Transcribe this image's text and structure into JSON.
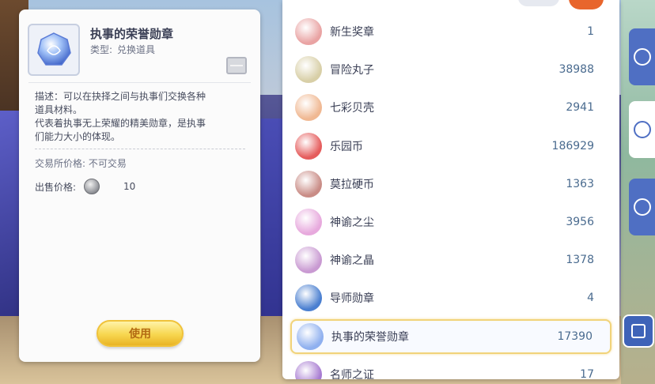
{
  "detail": {
    "item_name": "执事的荣誉勋章",
    "type_label": "类型:",
    "type_value": "兑换道具",
    "desc_line1": "描述：可以在抉择之间与执事们交换各种",
    "desc_line2": "道具材料。",
    "desc_line3": "代表着执事无上荣耀的精美勋章，是执事",
    "desc_line4": "们能力大小的体现。",
    "trade_label": "交易所价格:",
    "trade_value": "不可交易",
    "sell_label": "出售价格:",
    "sell_value": "10",
    "use_button": "使用"
  },
  "list": {
    "items": [
      {
        "name": "新生奖章",
        "count": "1",
        "icon": "badge-icon",
        "color": "#e9a3a3"
      },
      {
        "name": "冒险丸子",
        "count": "38988",
        "icon": "dango-icon",
        "color": "#d8cfa7"
      },
      {
        "name": "七彩贝壳",
        "count": "2941",
        "icon": "shell-icon",
        "color": "#f0b892"
      },
      {
        "name": "乐园币",
        "count": "186929",
        "icon": "park-coin-icon",
        "color": "#e55c5c"
      },
      {
        "name": "莫拉硬币",
        "count": "1363",
        "icon": "mora-coin-icon",
        "color": "#c98c86"
      },
      {
        "name": "神谕之尘",
        "count": "3956",
        "icon": "oracle-dust-icon",
        "color": "#e7a9dd"
      },
      {
        "name": "神谕之晶",
        "count": "1378",
        "icon": "oracle-crystal-icon",
        "color": "#c99ad2"
      },
      {
        "name": "导师勋章",
        "count": "4",
        "icon": "mentor-medal-icon",
        "color": "#4a7fd0"
      },
      {
        "name": "执事的荣誉勋章",
        "count": "17390",
        "icon": "butler-medal-icon",
        "color": "#8fb0ef"
      },
      {
        "name": "名师之证",
        "count": "17",
        "icon": "master-certificate-icon",
        "color": "#a77bd1"
      }
    ]
  },
  "colors": {
    "accent_blue": "#4f6fc3",
    "use_button": "#f7d64f",
    "selected_border": "#f1d37a"
  }
}
